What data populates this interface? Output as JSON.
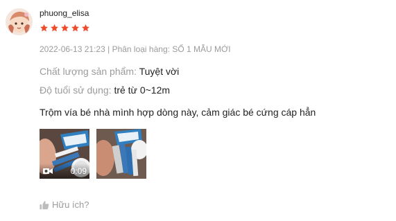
{
  "review": {
    "username": "phuong_elisa",
    "rating": 5,
    "rating_max": 5,
    "timestamp": "2022-06-13 21:23",
    "separator": "|",
    "variant_label": "Phân loại hàng:",
    "variant_value": "SỐ 1 MẪU MỚI",
    "attributes": [
      {
        "label": "Chất lượng sản phẩm:",
        "value": "Tuyệt vời"
      },
      {
        "label": "Độ tuổi sử dụng:",
        "value": "trẻ từ 0~12m"
      }
    ],
    "comment": "Trộm vía bé nhà mình hợp dòng này, cảm giác bé cứng cáp hẳn",
    "media": [
      {
        "type": "video",
        "duration": "0:09",
        "icon": "video-camera-icon"
      },
      {
        "type": "image"
      }
    ],
    "helpful_label": "Hữu ích?",
    "helpful_icon": "thumbs-up-icon"
  },
  "colors": {
    "star": "#ee4d2d",
    "muted_text": "#9b9b9b",
    "text": "#222222"
  }
}
